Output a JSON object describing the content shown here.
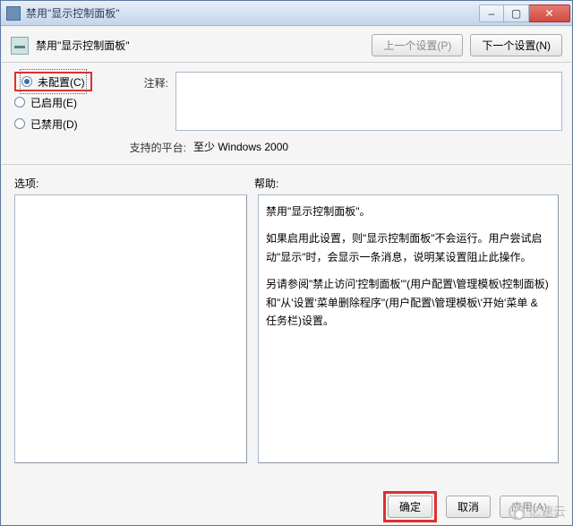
{
  "window": {
    "title": "禁用\"显示控制面板\""
  },
  "win_controls": {
    "minimize": "–",
    "maximize": "▢",
    "close": "✕"
  },
  "header": {
    "title": "禁用\"显示控制面板\"",
    "prev_btn": "上一个设置(P)",
    "next_btn": "下一个设置(N)"
  },
  "radios": {
    "not_configured": "未配置(C)",
    "enabled": "已启用(E)",
    "disabled": "已禁用(D)",
    "selected": "not_configured"
  },
  "fields": {
    "comment_label": "注释:",
    "comment_value": "",
    "platform_label": "支持的平台:",
    "platform_value": "至少 Windows 2000"
  },
  "panels": {
    "options_label": "选项:",
    "help_label": "帮助:",
    "help_text_p1": "禁用\"显示控制面板\"。",
    "help_text_p2": "如果启用此设置，则\"显示控制面板\"不会运行。用户尝试启动\"显示\"时，会显示一条消息，说明某设置阻止此操作。",
    "help_text_p3": "另请参阅\"禁止访问'控制面板'\"(用户配置\\管理模板\\控制面板)和\"从'设置'菜单删除程序\"(用户配置\\管理模板\\'开始'菜单 & 任务栏)设置。"
  },
  "footer": {
    "ok": "确定",
    "cancel": "取消",
    "apply": "应用(A)"
  },
  "watermark": "亿速云"
}
